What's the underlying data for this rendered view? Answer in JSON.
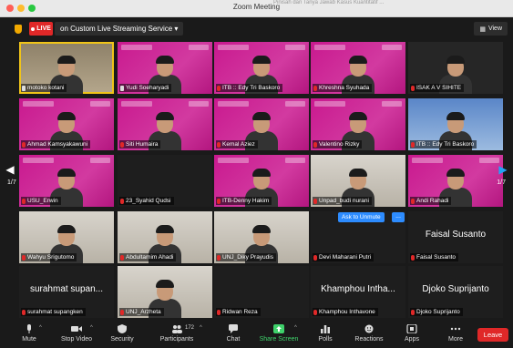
{
  "window": {
    "title": "Zoom Meeting",
    "background_title": "Pinisah dan Tanya Jawab Kasus Kuantitatif ..."
  },
  "topbar": {
    "live_label": "LIVE",
    "stream_label": "on Custom Live Streaming Service",
    "view_label": "View"
  },
  "pagination": {
    "left_page": "1/7",
    "right_page": "1/7"
  },
  "ask_to_unmute": "Ask to Unmute",
  "more_label": "...",
  "participants": [
    {
      "name": "motoko kotani",
      "style": "room",
      "mic": "pin",
      "active": true
    },
    {
      "name": "Yudi Soeharyadi",
      "style": "pink",
      "mic": "pin"
    },
    {
      "name": "ITB :: Edy Tri Baskoro",
      "style": "pink",
      "mic": "muted"
    },
    {
      "name": "Khreshna Syuhada",
      "style": "pink",
      "mic": "muted"
    },
    {
      "name": "ISAK A V SIHITE",
      "style": "gray",
      "mic": "muted"
    },
    {
      "name": "Ahmad Kamsyakawuni",
      "style": "pink",
      "mic": "muted"
    },
    {
      "name": "Siti Humaira",
      "style": "pink",
      "mic": "muted"
    },
    {
      "name": "Kemal Aziez",
      "style": "pink",
      "mic": "muted"
    },
    {
      "name": "Valentino Rizky",
      "style": "pink",
      "mic": "muted"
    },
    {
      "name": "ITB :: Edy Tri Baskoro",
      "style": "sky",
      "mic": "muted"
    },
    {
      "name": "USU_Erwin",
      "style": "pink",
      "mic": "muted"
    },
    {
      "name": "23_Syahid Qudsi",
      "style": "dark",
      "mic": "muted"
    },
    {
      "name": "ITB-Denny Hakim",
      "style": "pink",
      "mic": "muted"
    },
    {
      "name": "Unpad_budi nurani",
      "style": "wall",
      "mic": "muted"
    },
    {
      "name": "Andi Rahadi",
      "style": "pink",
      "mic": "muted"
    },
    {
      "name": "Wahyu Srigutomo",
      "style": "wall",
      "mic": "muted"
    },
    {
      "name": "Abdultamim Ahadi",
      "style": "wall",
      "mic": "muted"
    },
    {
      "name": "UNJ_Diky Prayudis",
      "style": "wall",
      "mic": "muted"
    },
    {
      "name": "Devi Maharani Putri",
      "style": "dark",
      "mic": "muted"
    },
    {
      "name": "Faisal Susanto",
      "style": "dark",
      "mic": "muted",
      "big_name": "Faisal Susanto"
    },
    {
      "name": "surahmat supangken",
      "style": "dark",
      "mic": "muted",
      "big_name": "surahmat supan..."
    },
    {
      "name": "UNJ_Arzheta",
      "style": "wall",
      "mic": "muted"
    },
    {
      "name": "Ridwan Reza",
      "style": "dark",
      "mic": "muted"
    },
    {
      "name": "Khamphou Inthavone",
      "style": "dark",
      "mic": "muted",
      "big_name": "Khamphou Intha..."
    },
    {
      "name": "Djoko Suprijanto",
      "style": "dark",
      "mic": "muted",
      "big_name": "Djoko Suprijanto"
    }
  ],
  "toolbar": {
    "mute": "Mute",
    "stop_video": "Stop Video",
    "security": "Security",
    "participants": "Participants",
    "participants_count": "172",
    "chat": "Chat",
    "share_screen": "Share Screen",
    "polls": "Polls",
    "reactions": "Reactions",
    "apps": "Apps",
    "more": "More",
    "leave": "Leave"
  },
  "colors": {
    "accent_blue": "#2d8cff",
    "leave_red": "#e02828",
    "share_green": "#3fd16b",
    "brand_pink": "#c9198f",
    "active_border": "#f0c419"
  }
}
